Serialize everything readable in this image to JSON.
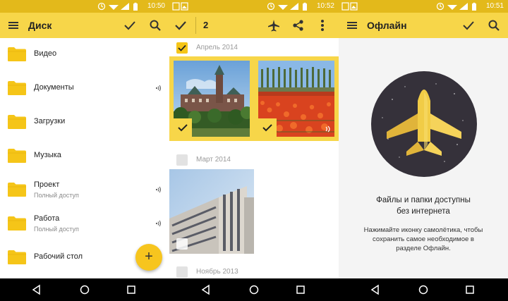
{
  "colors": {
    "accent": "#f7d649",
    "statusbar": "#e3b91b",
    "folder": "#f5c518",
    "circle": "#35313a"
  },
  "panel1": {
    "status_time": "10:50",
    "title": "Диск",
    "folders": [
      {
        "name": "Видео",
        "sub": "",
        "offline": false
      },
      {
        "name": "Документы",
        "sub": "",
        "offline": true
      },
      {
        "name": "Загрузки",
        "sub": "",
        "offline": false
      },
      {
        "name": "Музыка",
        "sub": "",
        "offline": false
      },
      {
        "name": "Проект",
        "sub": "Полный доступ",
        "offline": true
      },
      {
        "name": "Работа",
        "sub": "Полный доступ",
        "offline": true
      },
      {
        "name": "Рабочий стол",
        "sub": "",
        "offline": false
      }
    ],
    "fab_label": "+"
  },
  "panel2": {
    "status_time": "10:52",
    "selected_count": "2",
    "sections": [
      {
        "label": "Апрель 2014",
        "checked": true
      },
      {
        "label": "Март 2014",
        "checked": false
      },
      {
        "label": "Ноябрь 2013",
        "checked": false
      }
    ]
  },
  "panel3": {
    "status_time": "10:51",
    "title": "Офлайн",
    "headline_line1": "Файлы и папки доступны",
    "headline_line2": "без интернета",
    "body_line1": "Нажимайте иконку самолётика, чтобы",
    "body_line2": "сохранить самое необходимое в",
    "body_line3": "разделе Офлайн."
  }
}
